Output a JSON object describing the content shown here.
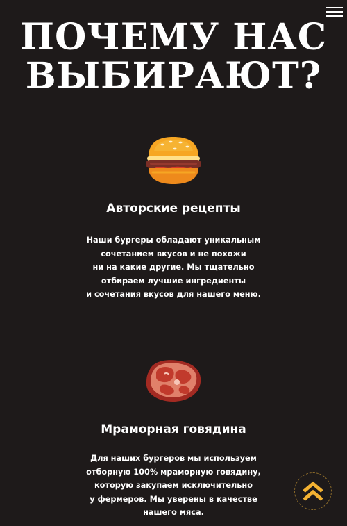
{
  "header": {
    "title_line1": "ПОЧЕМУ НАС",
    "title_line2": "ВЫБИРАЮТ?",
    "menu_icon": "hamburger-menu-icon"
  },
  "features": [
    {
      "icon": "burger-icon",
      "title": "Авторские рецепты",
      "lines": [
        "Наши бургеры обладают уникальным",
        "сочетанием вкусов и не похожи",
        "ни на какие другие. Мы тщательно",
        "отбираем лучшие ингредиенты",
        "и сочетания вкусов для нашего меню."
      ]
    },
    {
      "icon": "steak-icon",
      "title": "Мраморная говядина",
      "lines": [
        "Для наших бургеров мы используем",
        "отборную 100% мраморную говядину,",
        "которую закупаем исключительно",
        "у фермеров. Мы уверены в качестве",
        "нашего мяса."
      ]
    }
  ],
  "scroll_top": {
    "icon": "double-chevron-up-icon"
  },
  "colors": {
    "background": "#1e1a1a",
    "text": "#ffffff",
    "accent": "#f3b232"
  }
}
